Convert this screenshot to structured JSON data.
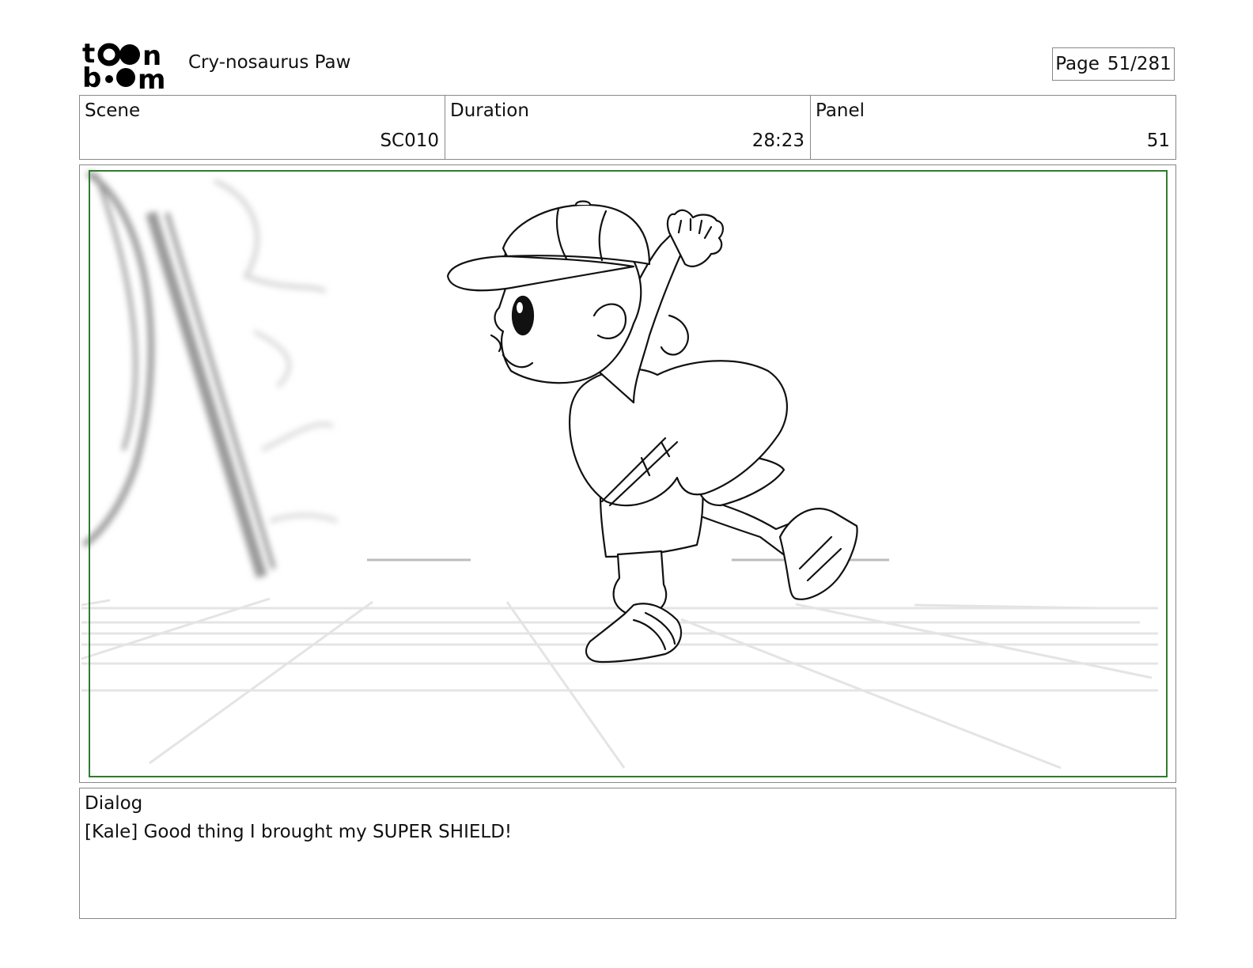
{
  "header": {
    "logo_text_top": "toon",
    "logo_text_bottom": "boom",
    "project_title": "Cry-nosaurus Paw",
    "page_label": "Page",
    "page_value": "51/281"
  },
  "meta": {
    "scene_label": "Scene",
    "scene_value": "SC010",
    "duration_label": "Duration",
    "duration_value": "28:23",
    "panel_label": "Panel",
    "panel_value": "51"
  },
  "dialog": {
    "label": "Dialog",
    "text": "[Kale] Good thing I brought my SUPER SHIELD!"
  },
  "colors": {
    "safe_area_border": "#2e7d2e",
    "frame_border": "#888888"
  }
}
